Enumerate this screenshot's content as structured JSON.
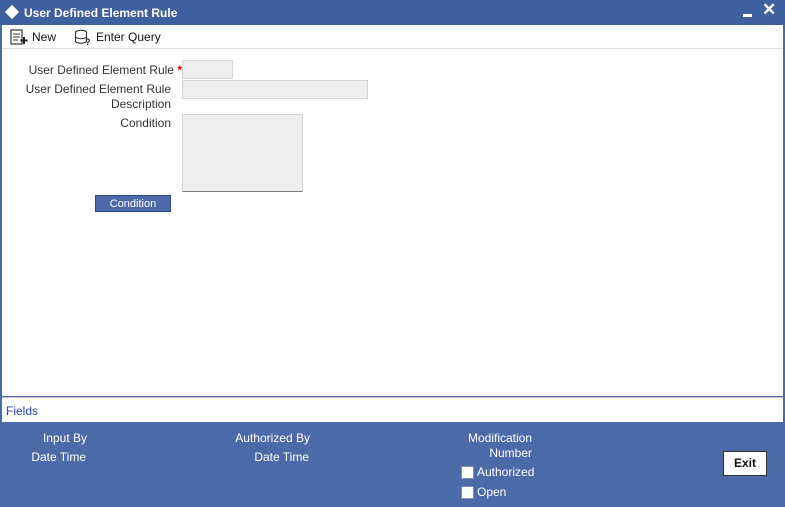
{
  "window": {
    "title": "User Defined Element Rule",
    "minimize_label": "",
    "close_label": "✕"
  },
  "toolbar": {
    "new_label": "New",
    "enter_query_label": "Enter Query"
  },
  "form": {
    "rule_label": "User Defined Element Rule",
    "required_mark": "*",
    "rule_value": "",
    "description_label_line1": "User Defined Element Rule",
    "description_label_line2": "Description",
    "description_value": "",
    "condition_label": "Condition",
    "condition_value": "",
    "condition_button_label": "Condition"
  },
  "fields_bar": {
    "label": "Fields"
  },
  "footer": {
    "input_by_label": "Input By",
    "date_time_label_1": "Date Time",
    "authorized_by_label": "Authorized By",
    "date_time_label_2": "Date Time",
    "modification_label": "Modification",
    "number_label": "Number",
    "authorized_checkbox_label": "Authorized",
    "authorized_checked": false,
    "open_checkbox_label": "Open",
    "open_checked": false,
    "exit_label": "Exit"
  }
}
